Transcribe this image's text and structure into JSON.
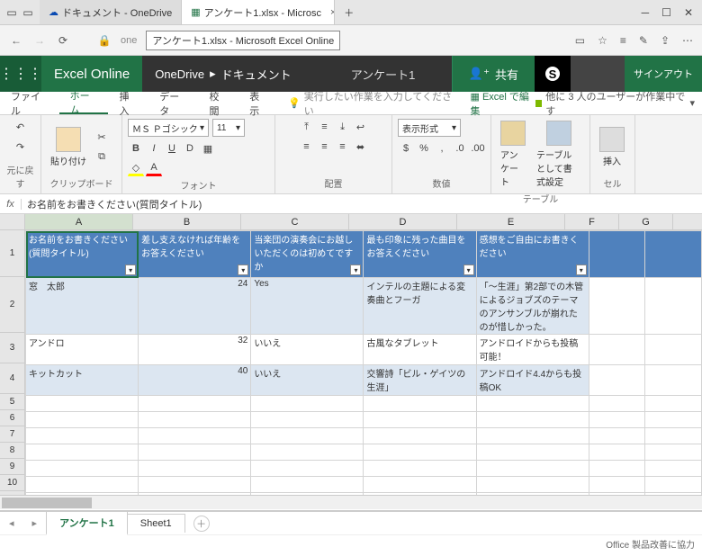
{
  "browser": {
    "tab1": "ドキュメント - OneDrive",
    "tab2": "アンケート1.xlsx - Microsc",
    "tooltip": "アンケート1.xlsx - Microsoft Excel Online",
    "url_prefix": "one"
  },
  "header": {
    "brand": "Excel Online",
    "crumb1": "OneDrive",
    "crumb2": "ドキュメント",
    "file": "アンケート1",
    "share": "共有",
    "signout": "サインアウト"
  },
  "ribbontabs": {
    "file": "ファイル",
    "home": "ホーム",
    "insert": "挿入",
    "data": "データ",
    "review": "校閲",
    "view": "表示",
    "tell": "実行したい作業を入力してください",
    "editexcel": "Excel で編集",
    "collab": "他に 3 人のユーザーが作業中です"
  },
  "ribbon": {
    "undo": "元に戻す",
    "paste": "貼り付け",
    "clipboard": "クリップボード",
    "fontname": "ＭＳ Ｐゴシック",
    "fontsize": "11",
    "fontgrp": "フォント",
    "align": "配置",
    "numfmt": "表示形式",
    "number": "数値",
    "survey": "アンケート",
    "tableformat": "テーブルとして書式設定",
    "tables": "テーブル",
    "ins": "挿入",
    "cells": "セル"
  },
  "fx": "お名前をお書きください(質問タイトル)",
  "cols": [
    "A",
    "B",
    "C",
    "D",
    "E",
    "F",
    "G"
  ],
  "headers": {
    "a": "お名前をお書きください(質問タイトル)",
    "b": "差し支えなければ年齢をお答えください",
    "c": "当楽団の演奏会にお越しいただくのは初めてですか",
    "d": "最も印象に残った曲目をお答えください",
    "e": "感想をご自由にお書きください"
  },
  "rows": [
    {
      "a": "窓　太郎",
      "b": "24",
      "c": "Yes",
      "d": "インテルの主題による変奏曲とフーガ",
      "e": "「～生涯」第2部での木管によるジョブズのテーマのアンサンブルが崩れたのが惜しかった。"
    },
    {
      "a": "アンドロ",
      "b": "32",
      "c": "いいえ",
      "d": "古風なタブレット",
      "e": "アンドロイドからも投稿可能！"
    },
    {
      "a": "キットカット",
      "b": "40",
      "c": "いいえ",
      "d": "交響詩「ビル・ゲイツの生涯」",
      "e": "アンドロイド4.4からも投稿OK"
    }
  ],
  "sheets": {
    "s1": "アンケート1",
    "s2": "Sheet1"
  },
  "status": "Office 製品改善に協力",
  "chart_data": null
}
